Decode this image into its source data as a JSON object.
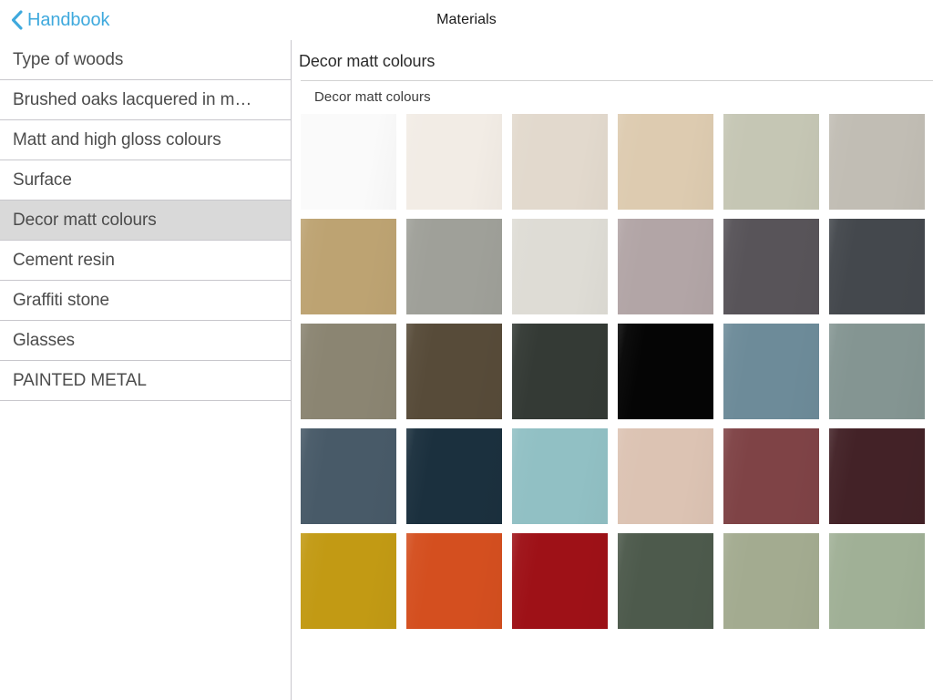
{
  "navbar": {
    "back_label": "Handbook",
    "back_icon": "chevron-left-icon",
    "title": "Materials",
    "tint_color": "#3fa9dd"
  },
  "sidebar": {
    "items": [
      {
        "label": "Type of woods",
        "selected": false
      },
      {
        "label": "Brushed oaks lacquered in m…",
        "selected": false
      },
      {
        "label": "Matt and high gloss colours",
        "selected": false
      },
      {
        "label": "Surface",
        "selected": false
      },
      {
        "label": "Decor matt colours",
        "selected": true
      },
      {
        "label": "Cement resin",
        "selected": false
      },
      {
        "label": "Graffiti stone",
        "selected": false
      },
      {
        "label": "Glasses",
        "selected": false
      },
      {
        "label": "PAINTED METAL",
        "selected": false
      }
    ],
    "selected_background": "#d9d9d9",
    "separator_color": "#c8c7cc"
  },
  "detail": {
    "title": "Decor matt colours",
    "group_label": "Decor matt colours",
    "swatches": [
      {
        "color": "#fafafa"
      },
      {
        "color": "#f2ece5"
      },
      {
        "color": "#e2d9cd"
      },
      {
        "color": "#ddcbb0"
      },
      {
        "color": "#c5c6b4"
      },
      {
        "color": "#c1bdb4"
      },
      {
        "color": "#bda372"
      },
      {
        "color": "#9fa099"
      },
      {
        "color": "#dedcd5"
      },
      {
        "color": "#b2a5a6"
      },
      {
        "color": "#585459"
      },
      {
        "color": "#44484d"
      },
      {
        "color": "#8b8572"
      },
      {
        "color": "#574b39"
      },
      {
        "color": "#343a35"
      },
      {
        "color": "#050505"
      },
      {
        "color": "#6d8b99"
      },
      {
        "color": "#849592"
      },
      {
        "color": "#485a68"
      },
      {
        "color": "#1b303e"
      },
      {
        "color": "#91c0c4"
      },
      {
        "color": "#dcc3b3"
      },
      {
        "color": "#7f4346"
      },
      {
        "color": "#432227"
      },
      {
        "color": "#c29a14"
      },
      {
        "color": "#d44f1f"
      },
      {
        "color": "#9e1117"
      },
      {
        "color": "#4d5a4c"
      },
      {
        "color": "#a3ab90"
      },
      {
        "color": "#a0b096"
      }
    ]
  }
}
